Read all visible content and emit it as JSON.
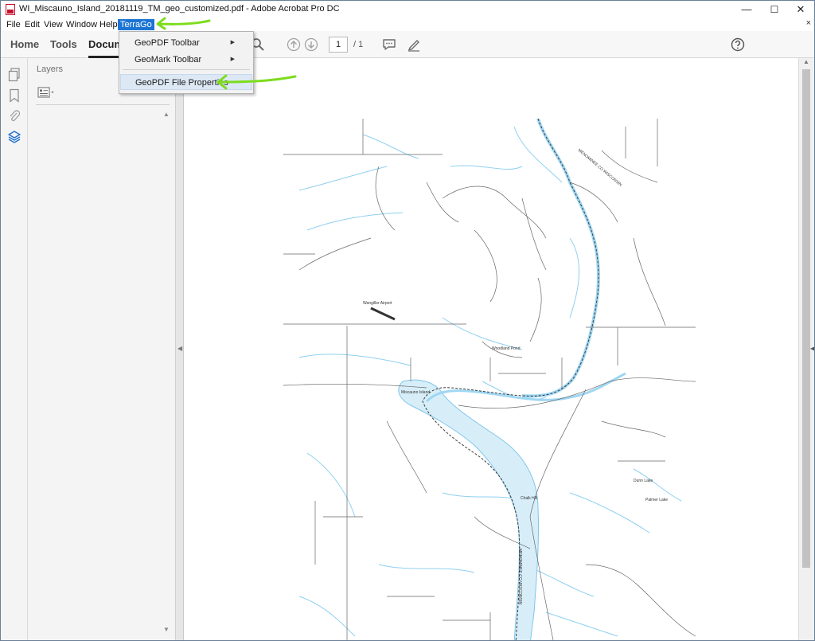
{
  "window": {
    "title": "WI_Miscauno_Island_20181119_TM_geo_customized.pdf - Adobe Acrobat Pro DC",
    "minimize": "—",
    "maximize": "☐",
    "close": "✕"
  },
  "menubar": {
    "items": [
      "File",
      "Edit",
      "View",
      "Window",
      "Help",
      "TerraGo"
    ],
    "active": "TerraGo",
    "close_doc": "×"
  },
  "toolbar": {
    "tabs": [
      "Home",
      "Tools",
      "Docum"
    ],
    "selected_tab": "Docum",
    "current_page": "1",
    "page_total": "/ 1"
  },
  "terrago_menu": {
    "items": [
      {
        "label": "GeoPDF Toolbar",
        "submenu": true
      },
      {
        "label": "GeoMark Toolbar",
        "submenu": true
      },
      {
        "label": "GeoPDF File Properties",
        "submenu": false
      }
    ],
    "highlighted": "GeoPDF File Properties"
  },
  "layers_panel": {
    "title": "Layers"
  },
  "map_labels": {
    "airport": "Wangiller Airport",
    "pond": "Woodland Pond",
    "island": "Miscauno Island",
    "hill": "Chalk Hill",
    "lake1": "Dunn Lake",
    "lake2": "Palmer Lake",
    "river_ne": "MENOMINEE CO WISCONSIN",
    "river_s": "MENOMINEE CO WISCONSIN"
  },
  "annotation": {
    "color": "#7ddc1f"
  }
}
